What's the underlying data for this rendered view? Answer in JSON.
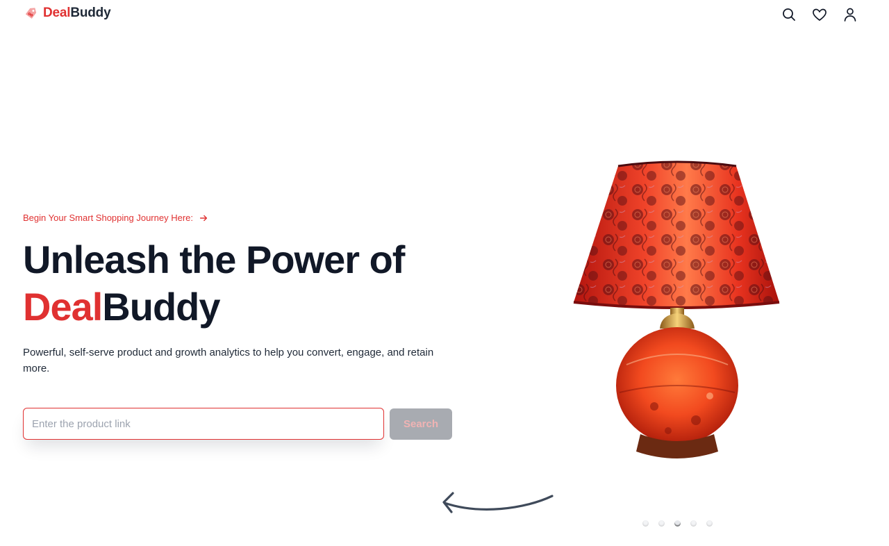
{
  "brand": {
    "part1": "Deal",
    "part2": "Buddy"
  },
  "nav": {
    "icons": [
      "search-icon",
      "heart-icon",
      "user-icon"
    ]
  },
  "hero": {
    "eyebrow": "Begin Your Smart Shopping Journey Here:",
    "headline_line1": "Unleash the Power of",
    "headline_brand1": "Deal",
    "headline_brand2": "Buddy",
    "subtitle": "Powerful, self-serve product and growth analytics to help you convert, engage, and retain more.",
    "search": {
      "placeholder": "Enter the product link",
      "value": "",
      "button_label": "Search"
    }
  },
  "carousel": {
    "dot_count": 5,
    "active_index": 2
  },
  "colors": {
    "accent": "#e03131",
    "text": "#111827",
    "button_bg": "#a8abb1",
    "button_text": "#f0b3b3"
  }
}
